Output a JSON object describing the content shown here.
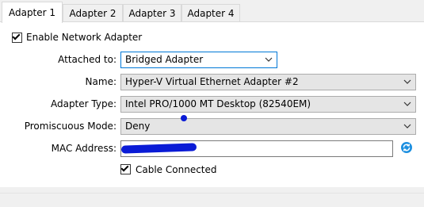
{
  "tabs": [
    {
      "label": "Adapter 1",
      "active": true
    },
    {
      "label": "Adapter 2",
      "active": false
    },
    {
      "label": "Adapter 3",
      "active": false
    },
    {
      "label": "Adapter 4",
      "active": false
    }
  ],
  "enable_adapter": {
    "label": "Enable Network Adapter",
    "checked": true
  },
  "fields": {
    "attached_to": {
      "label": "Attached to:",
      "value": "Bridged Adapter"
    },
    "name": {
      "label": "Name:",
      "value": "Hyper-V Virtual Ethernet Adapter #2"
    },
    "adapter_type": {
      "label": "Adapter Type:",
      "value": "Intel PRO/1000 MT Desktop (82540EM)"
    },
    "promiscuous_mode": {
      "label": "Promiscuous Mode:",
      "value": "Deny"
    },
    "mac_address": {
      "label": "MAC Address:",
      "value": ""
    }
  },
  "cable_connected": {
    "label": "Cable Connected",
    "checked": true
  },
  "icons": {
    "refresh": "refresh-mac-icon",
    "dropdown": "chevron-down-icon"
  },
  "colors": {
    "focus_border": "#0078d7",
    "redaction": "#0a1bd6",
    "refresh_icon": "#1c8fe0"
  }
}
